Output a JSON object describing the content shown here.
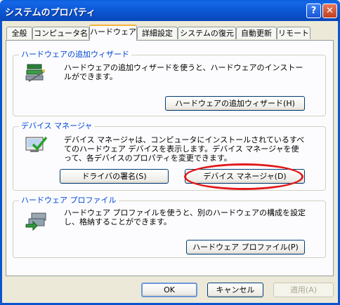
{
  "window": {
    "title": "システムのプロパティ",
    "help_label": "?",
    "close_label": "✕"
  },
  "tabs": [
    {
      "label": "全般"
    },
    {
      "label": "コンピュータ名"
    },
    {
      "label": "ハードウェア",
      "active": true
    },
    {
      "label": "詳細設定"
    },
    {
      "label": "システムの復元"
    },
    {
      "label": "自動更新"
    },
    {
      "label": "リモート"
    }
  ],
  "groups": {
    "add_hardware": {
      "label": "ハードウェアの追加ウィザード",
      "icon": "add-hardware-wizard-icon",
      "description": "ハードウェアの追加ウィザードを使うと、ハードウェアのインストールができます。",
      "button": "ハードウェアの追加ウィザード(H)"
    },
    "device_manager": {
      "label": "デバイス マネージャ",
      "icon": "device-manager-icon",
      "description": "デバイス マネージャは、コンピュータにインストールされているすべてのハードウェア デバイスを表示します。デバイス マネージャを使って、各デバイスのプロパティを変更できます。",
      "driver_signing_button": "ドライバの署名(S)",
      "device_manager_button": "デバイス マネージャ(D)"
    },
    "hardware_profiles": {
      "label": "ハードウェア プロファイル",
      "icon": "hardware-profiles-icon",
      "description": "ハードウェア プロファイルを使うと、別のハードウェアの構成を設定し、格納することができます。",
      "button": "ハードウェア プロファイル(P)"
    }
  },
  "footer": {
    "ok": "OK",
    "cancel": "キャンセル",
    "apply": "適用(A)"
  },
  "colors": {
    "highlight_ellipse": "#e0191b",
    "titlebar": "#0a54d0",
    "group_label": "#0046d5"
  }
}
